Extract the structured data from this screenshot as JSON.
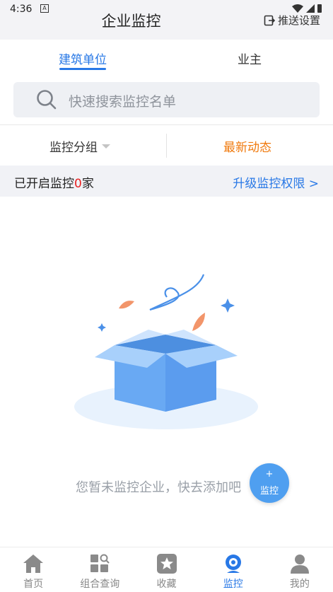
{
  "status_bar": {
    "time": "4:36",
    "badge": "A"
  },
  "header": {
    "title": "企业监控",
    "push_settings": "推送设置"
  },
  "tabs": [
    {
      "label": "建筑单位",
      "active": true
    },
    {
      "label": "业主",
      "active": false
    }
  ],
  "search": {
    "placeholder": "快速搜索监控名单"
  },
  "filter": {
    "group_label": "监控分组",
    "news_label": "最新动态"
  },
  "info": {
    "prefix": "已开启监控",
    "count": "0",
    "suffix": "家",
    "upgrade": "升级监控权限 >"
  },
  "empty_state": {
    "message": "您暂未监控企业，快去添加吧"
  },
  "fab": {
    "plus": "+",
    "label": "监控"
  },
  "bottom_nav": [
    {
      "label": "首页",
      "icon": "home-icon",
      "active": false
    },
    {
      "label": "组合查询",
      "icon": "grid-search-icon",
      "active": false
    },
    {
      "label": "收藏",
      "icon": "star-icon",
      "active": false
    },
    {
      "label": "监控",
      "icon": "camera-icon",
      "active": true
    },
    {
      "label": "我的",
      "icon": "person-icon",
      "active": false
    }
  ],
  "colors": {
    "accent": "#2878e6",
    "orange": "#f07a0e",
    "red": "#e82020",
    "fab": "#4f9ff0"
  }
}
